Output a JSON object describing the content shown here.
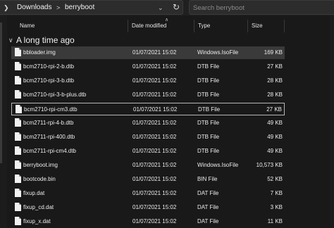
{
  "address_bar": {
    "lead_chevron_icon": "chevron-right-icon",
    "breadcrumbs": [
      "Downloads",
      "berryboot"
    ],
    "separator": ">",
    "dropdown_icon": "chevron-down-icon",
    "refresh_icon": "refresh-icon"
  },
  "search": {
    "placeholder": "Search berryboot"
  },
  "columns": {
    "name": "Name",
    "date": "Date modified",
    "type": "Type",
    "size": "Size"
  },
  "group": {
    "label": "A long time ago",
    "icon": "chevron-down-icon"
  },
  "files": [
    {
      "name": "bbloader.img",
      "date": "01/07/2021 15:02",
      "type": "Windows.IsoFile",
      "size": "169 KB"
    },
    {
      "name": "bcm2710-rpi-2-b.dtb",
      "date": "01/07/2021 15:02",
      "type": "DTB File",
      "size": "27 KB"
    },
    {
      "name": "bcm2710-rpi-3-b.dtb",
      "date": "01/07/2021 15:02",
      "type": "DTB File",
      "size": "28 KB"
    },
    {
      "name": "bcm2710-rpi-3-b-plus.dtb",
      "date": "01/07/2021 15:02",
      "type": "DTB File",
      "size": "28 KB"
    },
    {
      "name": "bcm2710-rpi-cm3.dtb",
      "date": "01/07/2021 15:02",
      "type": "DTB File",
      "size": "27 KB"
    },
    {
      "name": "bcm2711-rpi-4-b.dtb",
      "date": "01/07/2021 15:02",
      "type": "DTB File",
      "size": "49 KB"
    },
    {
      "name": "bcm2711-rpi-400.dtb",
      "date": "01/07/2021 15:02",
      "type": "DTB File",
      "size": "49 KB"
    },
    {
      "name": "bcm2711-rpi-cm4.dtb",
      "date": "01/07/2021 15:02",
      "type": "DTB File",
      "size": "49 KB"
    },
    {
      "name": "berryboot.img",
      "date": "01/07/2021 15:02",
      "type": "Windows.IsoFile",
      "size": "10,573 KB"
    },
    {
      "name": "bootcode.bin",
      "date": "01/07/2021 15:02",
      "type": "BIN File",
      "size": "52 KB"
    },
    {
      "name": "fixup.dat",
      "date": "01/07/2021 15:02",
      "type": "DAT File",
      "size": "7 KB"
    },
    {
      "name": "fixup_cd.dat",
      "date": "01/07/2021 15:02",
      "type": "DAT File",
      "size": "3 KB"
    },
    {
      "name": "fixup_x.dat",
      "date": "01/07/2021 15:02",
      "type": "DAT File",
      "size": "11 KB"
    }
  ]
}
